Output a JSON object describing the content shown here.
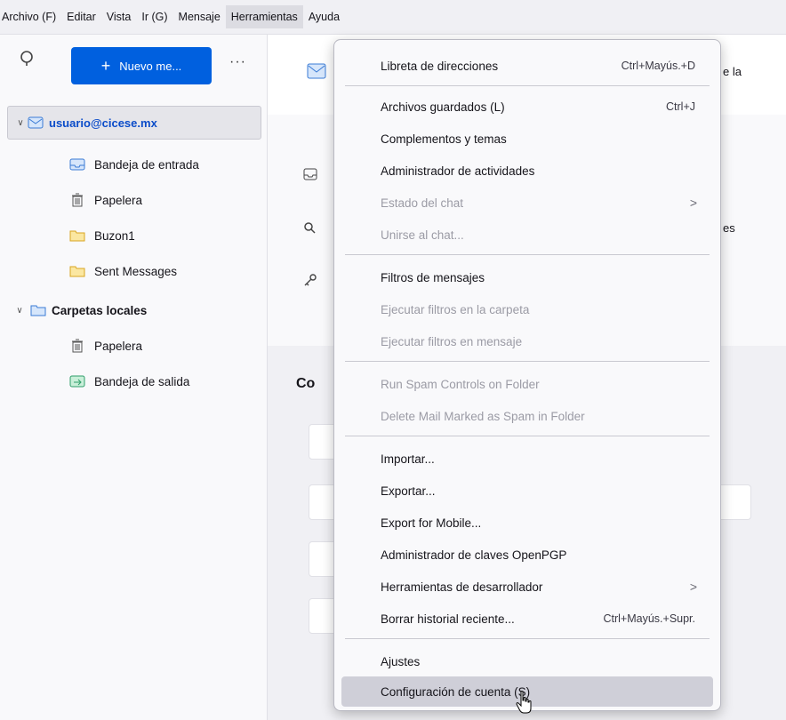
{
  "menubar": [
    {
      "label": "Archivo (F)",
      "active": false
    },
    {
      "label": "Editar",
      "active": false
    },
    {
      "label": "Vista",
      "active": false
    },
    {
      "label": "Ir (G)",
      "active": false
    },
    {
      "label": "Mensaje",
      "active": false
    },
    {
      "label": "Herramientas",
      "active": true
    },
    {
      "label": "Ayuda",
      "active": false
    }
  ],
  "folderpane": {
    "new_button_label": "Nuevo me...",
    "more_label": "···",
    "account": "usuario@cicese.mx",
    "folders": [
      {
        "label": "Bandeja de entrada",
        "icon": "inbox-icon"
      },
      {
        "label": "Papelera",
        "icon": "trash-icon"
      },
      {
        "label": "Buzon1",
        "icon": "folder-icon"
      },
      {
        "label": "Sent Messages",
        "icon": "folder-icon"
      }
    ],
    "local_folders": "Carpetas locales",
    "local_items": [
      {
        "label": "Papelera",
        "icon": "trash-icon"
      },
      {
        "label": "Bandeja de salida",
        "icon": "outbox-icon"
      }
    ]
  },
  "content": {
    "partial_top": "e la",
    "partial_mid": "es",
    "partial_heading": "Co"
  },
  "menu": {
    "items": [
      {
        "label": "Libreta de direcciones",
        "shortcut": "Ctrl+Mayús.+D",
        "disabled": false
      },
      {
        "label": "Archivos guardados (L)",
        "shortcut": "Ctrl+J",
        "disabled": false
      },
      {
        "label": "Complementos y temas",
        "shortcut": "",
        "disabled": false
      },
      {
        "label": "Administrador de actividades",
        "shortcut": "",
        "disabled": false
      },
      {
        "label": "Estado del chat",
        "shortcut": "",
        "disabled": true,
        "submenu": true
      },
      {
        "label": "Unirse al chat...",
        "shortcut": "",
        "disabled": true
      },
      {
        "label": "Filtros de mensajes",
        "shortcut": "",
        "disabled": false
      },
      {
        "label": "Ejecutar filtros en la carpeta",
        "shortcut": "",
        "disabled": true
      },
      {
        "label": "Ejecutar filtros en mensaje",
        "shortcut": "",
        "disabled": true
      },
      {
        "label": "Run Spam Controls on Folder",
        "shortcut": "",
        "disabled": true
      },
      {
        "label": "Delete Mail Marked as Spam in Folder",
        "shortcut": "",
        "disabled": true
      },
      {
        "label": "Importar...",
        "shortcut": "",
        "disabled": false
      },
      {
        "label": "Exportar...",
        "shortcut": "",
        "disabled": false
      },
      {
        "label": "Export for Mobile...",
        "shortcut": "",
        "disabled": false
      },
      {
        "label": "Administrador de claves OpenPGP",
        "shortcut": "",
        "disabled": false
      },
      {
        "label": "Herramientas de desarrollador",
        "shortcut": "",
        "disabled": false,
        "submenu": true
      },
      {
        "label": "Borrar historial reciente...",
        "shortcut": "Ctrl+Mayús.+Supr.",
        "disabled": false
      },
      {
        "label": "Ajustes",
        "shortcut": "",
        "disabled": false
      },
      {
        "label": "Configuración de cuenta (S)",
        "shortcut": "",
        "disabled": false,
        "hover": true
      }
    ],
    "submenu_arrow": ">"
  },
  "colors": {
    "accent": "#0060df",
    "account_text": "#0b4cc9",
    "hover": "#cfcfd8",
    "disabled": "#9b9ba5"
  }
}
